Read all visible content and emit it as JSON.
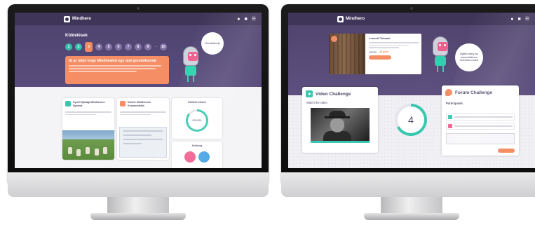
{
  "left_screen": {
    "nav": {
      "brand": "Mindhero",
      "icons": [
        "bell-icon",
        "user-icon",
        "menu-icon"
      ]
    },
    "hero": {
      "title": "Küldetések",
      "steps": [
        "1",
        "2",
        "3",
        "4",
        "5",
        "6",
        "7",
        "8",
        "9",
        "10"
      ],
      "current_step": 3,
      "banner_title": "Itt az idejé hogy Mindhealed egy újat gondolkoznál",
      "bubble_text": "Gondolkodj!"
    },
    "cards": [
      {
        "title": "Gyorfl Ifjúsági Mindheroes Nyomot"
      },
      {
        "title": "Karrier Mindheroes Kommunikáló"
      },
      {
        "title": "Értékelt ülések",
        "ring_text": "820/950"
      },
      {
        "title": "Szükség"
      }
    ]
  },
  "right_screen": {
    "nav": {
      "brand": "Mindhero",
      "icons": [
        "bell-icon",
        "user-icon",
        "menu-icon"
      ]
    },
    "promo": {
      "title": "Lunsuft Tokaast",
      "old_price": "pdrtotu",
      "new_price": "20 pont"
    },
    "bubble_text": "Újabb irány az ismeretekhez mehetsz most!",
    "video_challenge": {
      "title": "Video Challenge",
      "subtitle": "Watch the video"
    },
    "counter": {
      "value": "4"
    },
    "forum_challenge": {
      "title": "Forum Challenge",
      "subtitle": "Participants"
    },
    "colors": {
      "purple": "#4f4470",
      "teal": "#3ac7b0",
      "coral": "#f58d65"
    }
  }
}
